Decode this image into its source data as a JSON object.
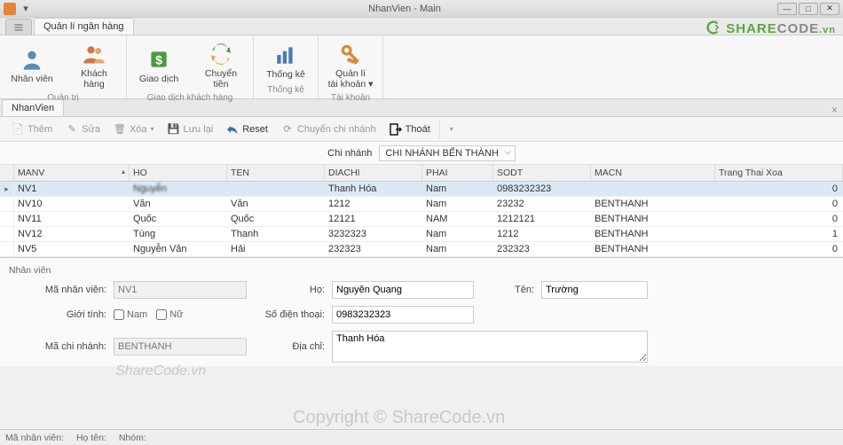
{
  "window": {
    "title": "NhanVien - Main"
  },
  "ribbon": {
    "tabLabel": "Quản lí ngân hàng",
    "groups": [
      {
        "label": "Quản trị",
        "items": [
          {
            "id": "nhanvien",
            "label": "Nhân viên"
          },
          {
            "id": "khachhang",
            "label": "Khách hàng"
          }
        ]
      },
      {
        "label": "Giao dịch khách hàng",
        "items": [
          {
            "id": "giaodich",
            "label": "Giao dịch"
          },
          {
            "id": "chuyentien",
            "label": "Chuyển tiền"
          }
        ]
      },
      {
        "label": "Thống kê",
        "items": [
          {
            "id": "thongke",
            "label": "Thống kê"
          }
        ]
      },
      {
        "label": "Tài khoản",
        "items": [
          {
            "id": "qltk",
            "label": "Quản lí\ntài khoản ▾"
          }
        ]
      }
    ]
  },
  "docTab": "NhanVien",
  "toolbar": {
    "them": "Thêm",
    "sua": "Sửa",
    "xoa": "Xóa",
    "luu": "Lưu lại",
    "reset": "Reset",
    "chuyencn": "Chuyển chi nhánh",
    "thoat": "Thoát"
  },
  "filter": {
    "label": "Chi nhánh",
    "value": "CHI NHÁNH BẾN THÀNH"
  },
  "columns": [
    "MANV",
    "HO",
    "TEN",
    "DIACHI",
    "PHAI",
    "SODT",
    "MACN",
    "Trang Thai Xoa"
  ],
  "rows": [
    {
      "sel": true,
      "manv": "NV1",
      "ho": "Nguyễn",
      "ten": "",
      "diachi": "Thanh Hóa",
      "phai": "Nam",
      "sodt": "0983232323",
      "macn": "",
      "ttx": "0",
      "blur": true
    },
    {
      "manv": "NV10",
      "ho": "Văn",
      "ten": "Văn",
      "diachi": "1212",
      "phai": "Nam",
      "sodt": "23232",
      "macn": "BENTHANH",
      "ttx": "0"
    },
    {
      "manv": "NV11",
      "ho": "Quốc",
      "ten": "Quốc",
      "diachi": "12121",
      "phai": "NAM",
      "sodt": "1212121",
      "macn": "BENTHANH",
      "ttx": "0"
    },
    {
      "manv": "NV12",
      "ho": "Tùng",
      "ten": "Thanh",
      "diachi": "3232323",
      "phai": "Nam",
      "sodt": "1212",
      "macn": "BENTHANH",
      "ttx": "1"
    },
    {
      "manv": "NV5",
      "ho": "Nguyễn Văn",
      "ten": "Hải",
      "diachi": "232323",
      "phai": "Nam",
      "sodt": "232323",
      "macn": "BENTHANH",
      "ttx": "0"
    }
  ],
  "detail": {
    "panelTitle": "Nhân viên",
    "labels": {
      "manv": "Mã nhân viên:",
      "ho": "Họ:",
      "ten": "Tên:",
      "gioitinh": "Giới tính:",
      "nam": "Nam",
      "nu": "Nữ",
      "sdt": "Số điện thoại:",
      "macn": "Mã chi nhánh:",
      "diachi": "Địa chỉ:"
    },
    "values": {
      "manv": "NV1",
      "ho": "Nguyễn Quang",
      "ten": "Trường",
      "sdt": "0983232323",
      "macn": "BENTHANH",
      "diachi": "Thanh Hóa"
    }
  },
  "status": {
    "manv": "Mã nhân viên:",
    "hoten": "Họ tên:",
    "nhom": "Nhóm:"
  },
  "watermark1": "ShareCode.vn",
  "watermark2": "Copyright © ShareCode.vn",
  "logo": {
    "p1": "SHARE",
    "p2": "CODE",
    "p3": ".vn"
  }
}
